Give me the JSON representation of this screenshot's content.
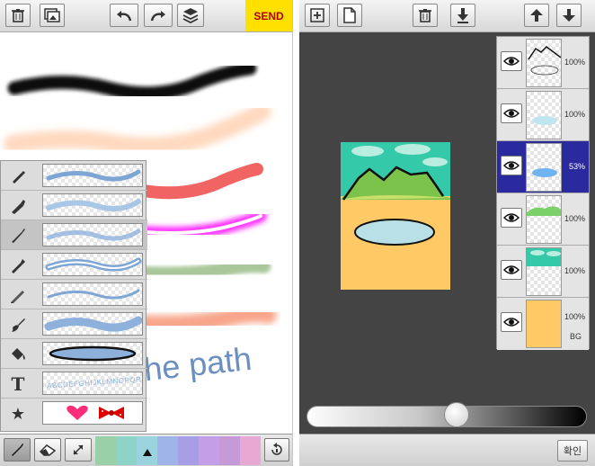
{
  "colors": {
    "send_bg": "#ffe000",
    "send_text": "#b00000",
    "selected_layer": "#2a2a9e",
    "layer_panel": "#d9d9d9",
    "dark_canvas": "#444444",
    "stroke_black": "#111111",
    "stroke_peach": "#ffd9bf",
    "stroke_red": "#f06464",
    "stroke_magenta": "#ff33ff",
    "stroke_green": "#a9c79a",
    "stroke_salmon": "#f8a58a",
    "text_path": "#6c8fbf"
  },
  "left_toolbar": {
    "icons": [
      "trash-icon",
      "image-gallery-icon",
      "undo-icon",
      "redo-icon",
      "layers-icon"
    ],
    "send_label": "SEND"
  },
  "left_canvas": {
    "text_on_path": "he path"
  },
  "brush_list": {
    "items": [
      {
        "icon": "pen-icon",
        "preview": "wavy-blue-line"
      },
      {
        "icon": "marker-icon",
        "preview": "wavy-light-blue-line"
      },
      {
        "icon": "airbrush-icon",
        "preview": "wavy-soft-line"
      },
      {
        "icon": "glow-pen-icon",
        "preview": "wavy-glow-line"
      },
      {
        "icon": "pencil-icon",
        "preview": "wavy-thin-line"
      },
      {
        "icon": "paintbrush-icon",
        "preview": "wavy-thick-line"
      },
      {
        "icon": "paint-bucket-icon",
        "preview": "ellipse-fill"
      },
      {
        "icon": "text-icon",
        "symbol": "T",
        "preview_text": "ABCDEFGHIJKLMNOPQR"
      },
      {
        "icon": "star-icon",
        "preview": "heart-and-bow-stamps"
      }
    ],
    "selected_index": 2
  },
  "left_bottom": {
    "tools": [
      "brush-tool-icon",
      "eraser-icon",
      "resize-icon"
    ],
    "swatches": [
      "#9ad0a8",
      "#8fd2c8",
      "#9ad3de",
      "#9fb4e8",
      "#a89ee6",
      "#c49fe8",
      "#c59ad6",
      "#e7a9d3"
    ],
    "selected_swatch_index": 2,
    "rotate_icon": "rotate-icon"
  },
  "right_toolbar": {
    "icons": [
      "add-layer-icon",
      "duplicate-layer-icon",
      "delete-layer-icon",
      "merge-down-icon",
      "move-up-icon",
      "move-down-icon"
    ]
  },
  "layers": [
    {
      "opacity": "100%",
      "thumb": "mountain-outline"
    },
    {
      "opacity": "100%",
      "thumb": "light-blue-pond"
    },
    {
      "opacity": "53%",
      "thumb": "blue-pond",
      "selected": true
    },
    {
      "opacity": "100%",
      "thumb": "green-hills"
    },
    {
      "opacity": "100%",
      "thumb": "teal-clouds"
    },
    {
      "opacity": "100%",
      "thumb": "orange-background",
      "label": "BG"
    }
  ],
  "opacity_slider": {
    "value_fraction": 0.54
  },
  "right_bottom": {
    "confirm_label": "확인"
  }
}
